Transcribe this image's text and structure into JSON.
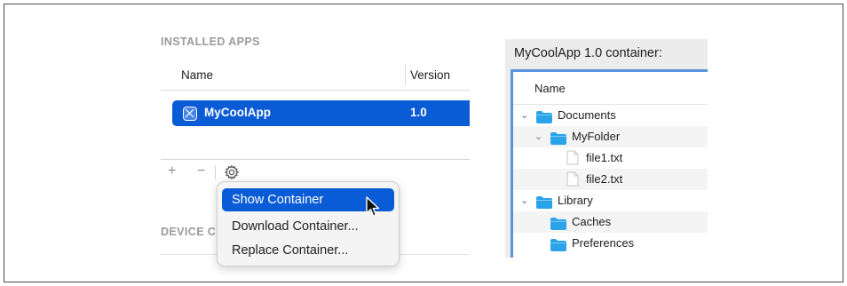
{
  "installed_apps": {
    "section_title": "INSTALLED APPS",
    "columns": {
      "name": "Name",
      "version": "Version"
    },
    "apps": [
      {
        "name": "MyCoolApp",
        "version": "1.0",
        "selected": true
      }
    ],
    "toolbar": {
      "add": "+",
      "remove": "−",
      "settings_icon": "gear-icon"
    }
  },
  "device_section": {
    "title_visible": "DEVICE C"
  },
  "context_menu": {
    "items": [
      {
        "label": "Show Container",
        "highlighted": true
      },
      {
        "label": "Download Container..."
      },
      {
        "label": "Replace Container..."
      }
    ]
  },
  "container_panel": {
    "title": "MyCoolApp 1.0 container:",
    "column_header": "Name",
    "tree": [
      {
        "label": "Documents",
        "kind": "folder",
        "depth": 0,
        "expanded": true
      },
      {
        "label": "MyFolder",
        "kind": "folder",
        "depth": 1,
        "expanded": true
      },
      {
        "label": "file1.txt",
        "kind": "file",
        "depth": 2
      },
      {
        "label": "file2.txt",
        "kind": "file",
        "depth": 2
      },
      {
        "label": "Library",
        "kind": "folder",
        "depth": 0,
        "expanded": true
      },
      {
        "label": "Caches",
        "kind": "folder",
        "depth": 1
      },
      {
        "label": "Preferences",
        "kind": "folder",
        "depth": 1
      }
    ]
  },
  "colors": {
    "accent": "#0a5bd6",
    "folder": "#2aa3e8",
    "panel_border": "#5b94de"
  }
}
